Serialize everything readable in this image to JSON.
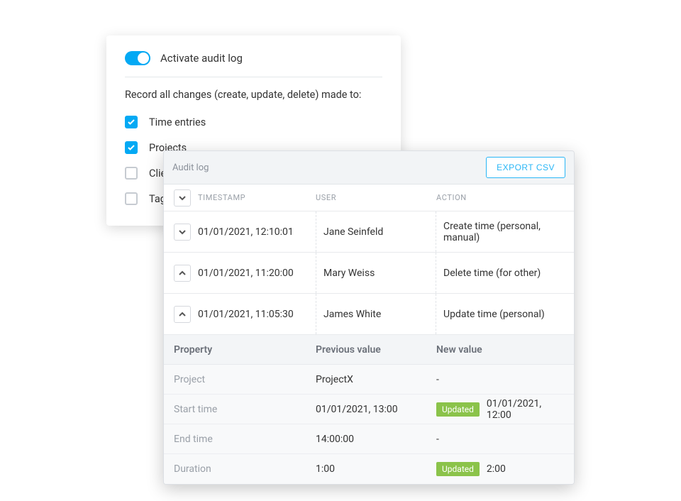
{
  "settings": {
    "toggle_label": "Activate audit log",
    "toggle_on": true,
    "description": "Record all changes (create, update, delete) made to:",
    "options": [
      {
        "label": "Time entries",
        "checked": true
      },
      {
        "label": "Projects",
        "checked": true
      },
      {
        "label": "Clients",
        "checked": false
      },
      {
        "label": "Tags",
        "checked": false
      }
    ]
  },
  "audit": {
    "title": "Audit log",
    "export_label": "EXPORT CSV",
    "columns": {
      "timestamp": "TIMESTAMP",
      "user": "USER",
      "action": "ACTION"
    },
    "rows": [
      {
        "expanded": false,
        "timestamp": "01/01/2021, 12:10:01",
        "user": "Jane Seinfeld",
        "action": "Create time (personal, manual)"
      },
      {
        "expanded": true,
        "timestamp": "01/01/2021, 11:20:00",
        "user": "Mary Weiss",
        "action": "Delete time (for other)"
      },
      {
        "expanded": true,
        "timestamp": "01/01/2021, 11:05:30",
        "user": "James White",
        "action": "Update time (personal)"
      }
    ],
    "detail_headers": {
      "property": "Property",
      "previous": "Previous value",
      "new": "New value"
    },
    "detail_rows": [
      {
        "property": "Project",
        "previous": "ProjectX",
        "new_badge": "",
        "new_value": "-"
      },
      {
        "property": "Start time",
        "previous": "01/01/2021, 13:00",
        "new_badge": "Updated",
        "new_value": "01/01/2021, 12:00"
      },
      {
        "property": "End time",
        "previous": "14:00:00",
        "new_badge": "",
        "new_value": "-"
      },
      {
        "property": "Duration",
        "previous": "1:00",
        "new_badge": "Updated",
        "new_value": "2:00"
      }
    ]
  }
}
